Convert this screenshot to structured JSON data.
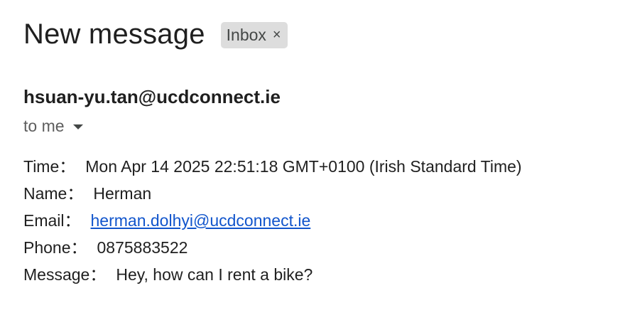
{
  "email": {
    "subject": "New message",
    "label_chip": {
      "label": "Inbox",
      "close_glyph": "×"
    },
    "sender": "hsuan-yu.tan@ucdconnect.ie",
    "recipient_label": "to me",
    "separator": "：",
    "fields": {
      "time": {
        "label": "Time",
        "value": "Mon Apr 14 2025 22:51:18 GMT+0100 (Irish Standard Time)"
      },
      "name": {
        "label": "Name",
        "value": "Herman"
      },
      "email": {
        "label": "Email",
        "value": "herman.dolhyi@ucdconnect.ie"
      },
      "phone": {
        "label": "Phone",
        "value": "0875883522"
      },
      "message": {
        "label": "Message",
        "value": "Hey, how can I rent a bike?"
      }
    }
  },
  "colors": {
    "link": "#1155cc",
    "chip_bg": "#dddddd",
    "text": "#1f1f1f",
    "muted": "#5e5e5e"
  }
}
